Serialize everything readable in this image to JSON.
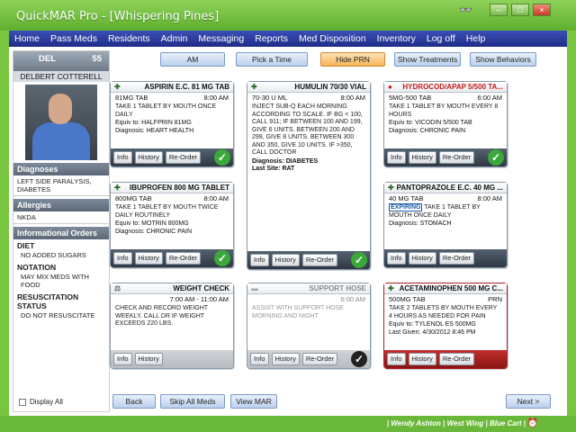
{
  "window": {
    "title": "QuickMAR Pro - [Whispering Pines]",
    "controls": [
      "–",
      "□",
      "×"
    ],
    "glasses_icon": "glasses-icon"
  },
  "menu": [
    "Home",
    "Pass Meds",
    "Residents",
    "Admin",
    "Messaging",
    "Reports",
    "Med Disposition",
    "Inventory",
    "Log off",
    "Help"
  ],
  "patient": {
    "code": "DEL",
    "room": "55",
    "name": "DELBERT COTTERELL",
    "diagnoses_label": "Diagnoses",
    "diagnoses": "LEFT SIDE PARALYSIS, DIABETES",
    "allergies_label": "Allergies",
    "allergies": "NKDA",
    "info_label": "Informational Orders",
    "diet_label": "DIET",
    "diet": "NO ADDED SUGARS",
    "notation_label": "NOTATION",
    "notation": "MAY MIX MEDS WITH FOOD",
    "resus_label": "RESUSCITATION STATUS",
    "resus": "DO NOT RESUSCITATE",
    "display_all": "Display All"
  },
  "toolbar": {
    "period": "AM",
    "pick_time": "Pick a Time",
    "hide_prn": "Hide PRN",
    "show_treatments": "Show Treatments",
    "show_behaviors": "Show Behaviors"
  },
  "card_buttons": {
    "info": "Info",
    "history": "History",
    "reorder": "Re-Order"
  },
  "cards": [
    {
      "title": "ASPIRIN E.C. 81 MG TAB",
      "dose": "81MG TAB",
      "time": "8:00 AM",
      "instr": "TAKE 1 TABLET BY MOUTH ONCE DAILY",
      "equiv": "Equiv to: HALFPRIN 81MG",
      "diag": "Diagnosis: HEART HEALTH"
    },
    {
      "title": "HUMULIN 70/30 VIAL",
      "dose": "70-30 U ML",
      "time": "8:00 AM",
      "instr": "INJECT SUB-Q EACH MORNING ACCORDING TO SCALE. IF BG < 100, CALL 911; IF BETWEEN 100 AND 199, GIVE 6 UNITS. BETWEEN 200 AND 299, GIVE 8 UNITS. BETWEEN 300 AND 350, GIVE 10 UNITS. IF >350, CALL DOCTOR",
      "equiv": "Diagnosis: DIABETES",
      "diag": "Last Site: RAT"
    },
    {
      "title": "HYDROCOD/APAP 5/500 TA...",
      "dose": "5MG-500 TAB",
      "time": "6:00 AM",
      "instr": "TAKE 1 TABLET BY MOUTH EVERY 8 HOURS",
      "equiv": "Equiv to: VICODIN 5/500 TAB",
      "diag": "Diagnosis: CHRONIC PAIN"
    },
    {
      "title": "IBUPROFEN 800 MG TABLET",
      "dose": "800MG TAB",
      "time": "8:00 AM",
      "instr": "TAKE 1 TABLET BY MOUTH TWICE DAILY ROUTINELY",
      "equiv": "Equiv to: MOTRIN 800MG",
      "diag": "Diagnosis: CHRONIC PAIN"
    },
    {
      "title": "PANTOPRAZOLE E.C. 40 MG ...",
      "dose": "40 MG TAB",
      "time": "8:00 AM",
      "expiring": "EXPIRING",
      "instr": "TAKE 1 TABLET BY MOUTH ONCE DAILY",
      "equiv": "",
      "diag": "Diagnosis: STOMACH"
    },
    {
      "title": "WEIGHT CHECK",
      "dose": "",
      "time": "7:00 AM - 11:00 AM",
      "instr": "CHECK AND RECORD WEIGHT WEEKLY. CALL DR IF WEIGHT EXCEEDS 220 LBS.",
      "equiv": "",
      "diag": ""
    },
    {
      "title": "SUPPORT HOSE",
      "dose": "",
      "time": "6:00 AM",
      "instr": "ASSIST WITH SUPPORT HOSE MORNING AND NIGHT",
      "equiv": "",
      "diag": ""
    },
    {
      "title": "ACETAMINOPHEN 500 MG C...",
      "dose": "500MG TAB",
      "time": "PRN",
      "instr": "TAKE 2 TABLETS BY MOUTH EVERY 4 HOURS AS NEEDED FOR PAIN",
      "equiv": "Equiv to: TYLENOL ES 500MG",
      "diag": "Last Given: 4/30/2012 8:46 PM"
    }
  ],
  "nav": {
    "back": "Back",
    "skip_all": "Skip All Meds",
    "view_mar": "View MAR",
    "next": "Next >"
  },
  "status": "| Wendy Ashton | West Wing | Blue Cart |"
}
